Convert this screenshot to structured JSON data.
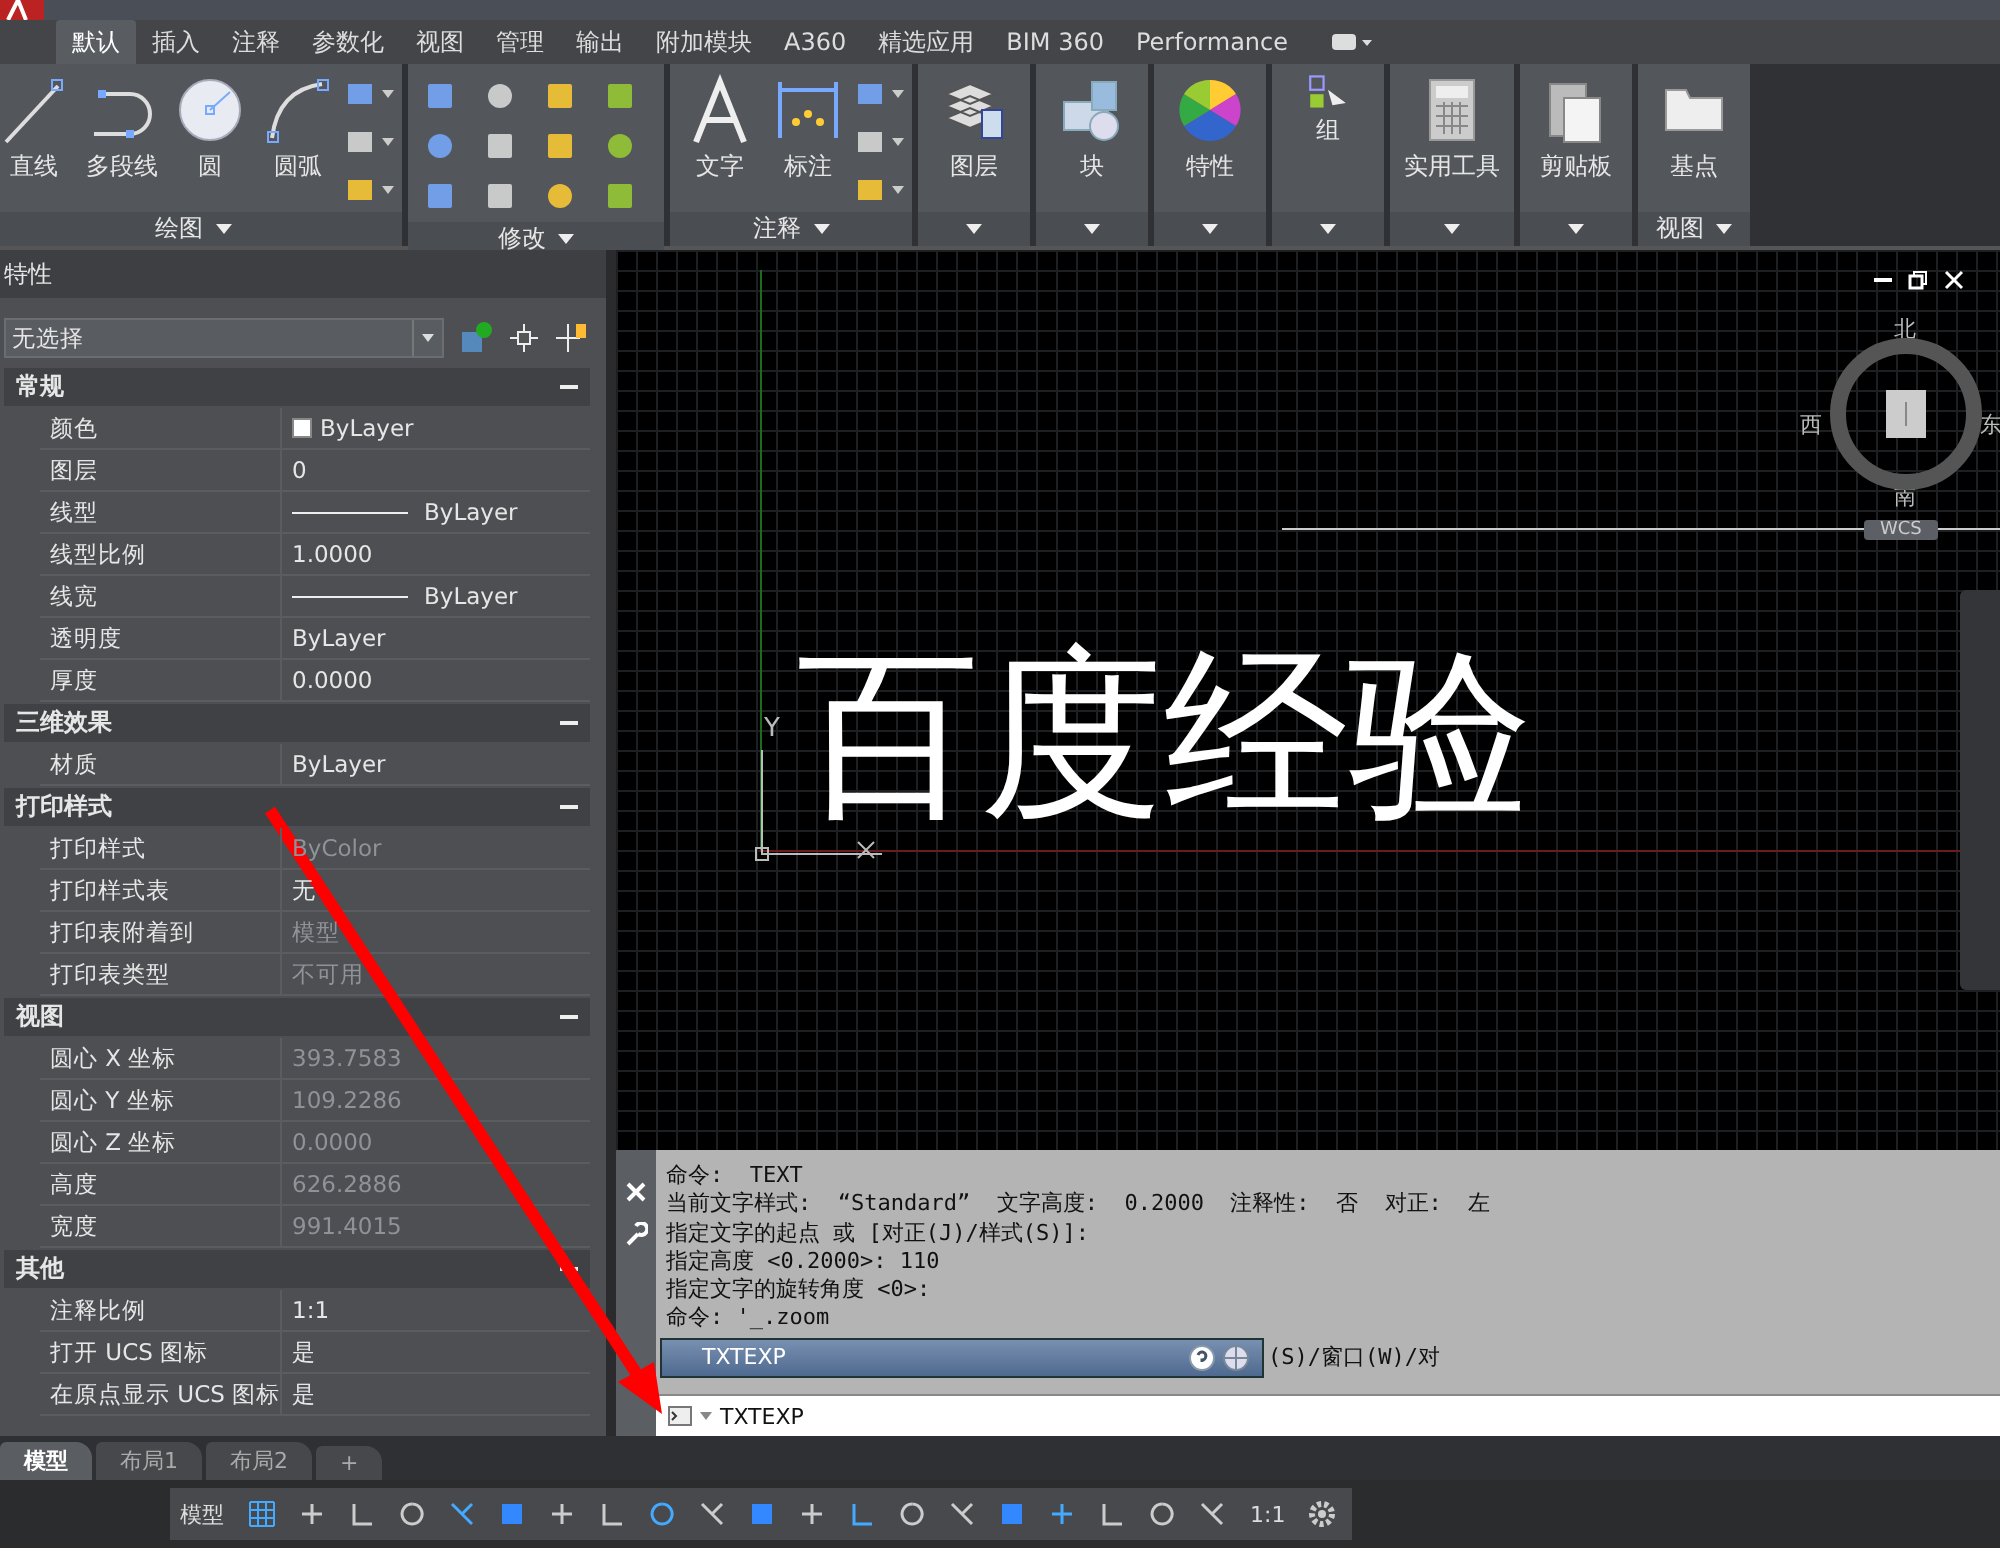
{
  "ribbon_tabs": [
    {
      "label": "默认",
      "selected": true
    },
    {
      "label": "插入",
      "selected": false
    },
    {
      "label": "注释",
      "selected": false
    },
    {
      "label": "参数化",
      "selected": false
    },
    {
      "label": "视图",
      "selected": false
    },
    {
      "label": "管理",
      "selected": false
    },
    {
      "label": "输出",
      "selected": false
    },
    {
      "label": "附加模块",
      "selected": false
    },
    {
      "label": "A360",
      "selected": false
    },
    {
      "label": "精选应用",
      "selected": false
    },
    {
      "label": "BIM 360",
      "selected": false
    },
    {
      "label": "Performance",
      "selected": false
    }
  ],
  "ribbon_panels": [
    {
      "kind": "draw",
      "title": "绘图",
      "tools": [
        {
          "label": "直线",
          "kind": "line"
        },
        {
          "label": "多段线",
          "kind": "polyline"
        },
        {
          "label": "圆",
          "kind": "circle"
        },
        {
          "label": "圆弧",
          "kind": "arc"
        }
      ]
    },
    {
      "kind": "modify",
      "title": "修改"
    },
    {
      "kind": "annotate",
      "title": "注释",
      "tools": [
        {
          "label": "文字",
          "kind": "text"
        },
        {
          "label": "标注",
          "kind": "dimension"
        }
      ]
    },
    {
      "kind": "single",
      "tools": [
        {
          "label": "图层",
          "kind": "layers"
        }
      ]
    },
    {
      "kind": "single",
      "tools": [
        {
          "label": "块",
          "kind": "block"
        }
      ]
    },
    {
      "kind": "single",
      "tools": [
        {
          "label": "特性",
          "kind": "properties"
        }
      ]
    },
    {
      "kind": "single",
      "tools": [
        {
          "label": "组",
          "kind": "group"
        }
      ]
    },
    {
      "kind": "single",
      "tools": [
        {
          "label": "实用工具",
          "kind": "calculator"
        }
      ]
    },
    {
      "kind": "single",
      "tools": [
        {
          "label": "剪贴板",
          "kind": "clipboard"
        }
      ]
    },
    {
      "kind": "view",
      "title": "视图",
      "tools": [
        {
          "label": "基点",
          "kind": "basepoint"
        }
      ]
    }
  ],
  "properties": {
    "title": "特性",
    "selection": "无选择",
    "sections": [
      {
        "title": "常规",
        "expanded": true,
        "rows": [
          {
            "label": "颜色",
            "value": "ByLayer",
            "kind": "color",
            "disabled": false
          },
          {
            "label": "图层",
            "value": "0",
            "kind": "text",
            "disabled": false
          },
          {
            "label": "线型",
            "value": "ByLayer",
            "kind": "linetype",
            "disabled": false
          },
          {
            "label": "线型比例",
            "value": "1.0000",
            "kind": "text",
            "disabled": false
          },
          {
            "label": "线宽",
            "value": "ByLayer",
            "kind": "linetype",
            "disabled": false
          },
          {
            "label": "透明度",
            "value": "ByLayer",
            "kind": "text",
            "disabled": false
          },
          {
            "label": "厚度",
            "value": "0.0000",
            "kind": "text",
            "disabled": false
          }
        ]
      },
      {
        "title": "三维效果",
        "expanded": true,
        "rows": [
          {
            "label": "材质",
            "value": "ByLayer",
            "kind": "text",
            "disabled": false
          }
        ]
      },
      {
        "title": "打印样式",
        "expanded": true,
        "rows": [
          {
            "label": "打印样式",
            "value": "ByColor",
            "kind": "text",
            "disabled": true
          },
          {
            "label": "打印样式表",
            "value": "无",
            "kind": "text",
            "disabled": false
          },
          {
            "label": "打印表附着到",
            "value": "模型",
            "kind": "text",
            "disabled": true
          },
          {
            "label": "打印表类型",
            "value": "不可用",
            "kind": "text",
            "disabled": true
          }
        ]
      },
      {
        "title": "视图",
        "expanded": true,
        "rows": [
          {
            "label": "圆心 X 坐标",
            "value": "393.7583",
            "kind": "text",
            "disabled": true
          },
          {
            "label": "圆心 Y 坐标",
            "value": "109.2286",
            "kind": "text",
            "disabled": true
          },
          {
            "label": "圆心 Z 坐标",
            "value": "0.0000",
            "kind": "text",
            "disabled": true
          },
          {
            "label": "高度",
            "value": "626.2886",
            "kind": "text",
            "disabled": true
          },
          {
            "label": "宽度",
            "value": "991.4015",
            "kind": "text",
            "disabled": true
          }
        ]
      },
      {
        "title": "其他",
        "expanded": true,
        "rows": [
          {
            "label": "注释比例",
            "value": "1:1",
            "kind": "text",
            "disabled": false
          },
          {
            "label": "打开 UCS 图标",
            "value": "是",
            "kind": "text",
            "disabled": false
          },
          {
            "label": "在原点显示 UCS 图标",
            "value": "是",
            "kind": "text",
            "disabled": false
          }
        ]
      }
    ]
  },
  "canvas": {
    "drawing_text": "百度经验",
    "ucs_y_label": "Y",
    "viewcube": {
      "north": "北",
      "west": "西",
      "east": "东",
      "south": "南",
      "wcs": "WCS"
    }
  },
  "command_window": {
    "history": [
      "命令:  TEXT",
      "当前文字样式:  “Standard”  文字高度:  0.2000  注释性:  否  对正:  左",
      "指定文字的起点 或 [对正(J)/样式(S)]:",
      "指定高度 <0.2000>: 110",
      "指定文字的旋转角度 <0>:",
      "命令: '_.zoom"
    ],
    "covered_line_tail": "(S)/窗口(W)/对",
    "autocomplete": "TXTEXP",
    "input": "TXTEXP"
  },
  "layout_tabs": [
    {
      "label": "模型",
      "selected": true
    },
    {
      "label": "布局1",
      "selected": false
    },
    {
      "label": "布局2",
      "selected": false
    },
    {
      "label": "+",
      "selected": false
    }
  ],
  "status_bar": {
    "space": "模型",
    "scale": "1:1"
  }
}
